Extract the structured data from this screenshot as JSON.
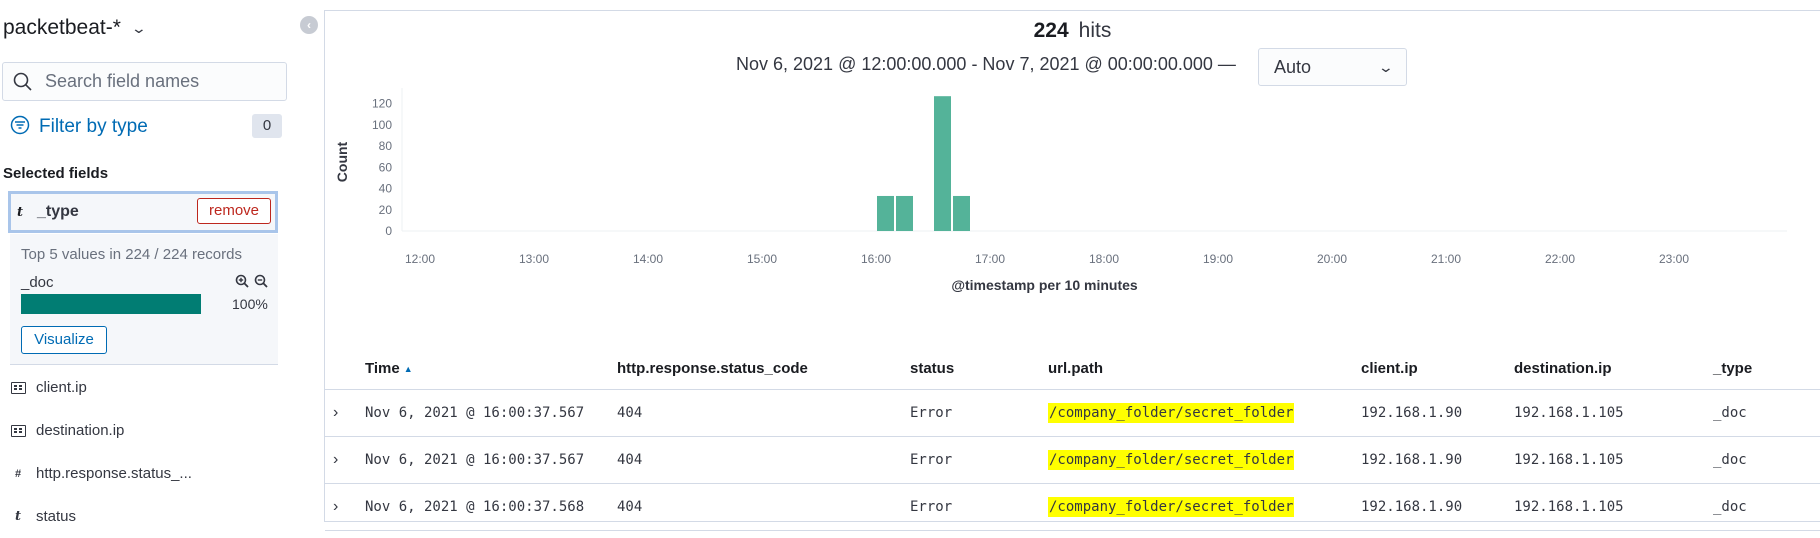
{
  "sidebar": {
    "index_pattern": "packetbeat-*",
    "search_placeholder": "Search field names",
    "filter_label": "Filter by type",
    "filter_count": "0",
    "selected_fields_title": "Selected fields",
    "selected_field": {
      "type": "t",
      "name": "_type",
      "remove_label": "remove",
      "top_values_caption": "Top 5 values in 224 / 224 records",
      "value_name": "_doc",
      "value_percent": "100%",
      "value_fraction": 1.0,
      "visualize_label": "Visualize"
    },
    "fields": [
      {
        "type": "ip",
        "name": "client.ip"
      },
      {
        "type": "ip",
        "name": "destination.ip"
      },
      {
        "type": "#",
        "name": "http.response.status_..."
      },
      {
        "type": "t",
        "name": "status"
      }
    ]
  },
  "main": {
    "hits_count": "224",
    "hits_label": "hits",
    "time_range": "Nov 6, 2021 @ 12:00:00.000 - Nov 7, 2021 @ 00:00:00.000 —",
    "interval": "Auto"
  },
  "chart_data": {
    "type": "bar",
    "ylabel": "Count",
    "xlabel": "@timestamp per 10 minutes",
    "ylim": [
      0,
      130
    ],
    "yticks": [
      0,
      20,
      40,
      60,
      80,
      100,
      120
    ],
    "xticks": [
      "12:00",
      "13:00",
      "14:00",
      "15:00",
      "16:00",
      "17:00",
      "18:00",
      "19:00",
      "20:00",
      "21:00",
      "22:00",
      "23:00"
    ],
    "x_range": [
      "12:00",
      "24:00"
    ],
    "bar_width_minutes": 10,
    "color": "#54b399",
    "bars": [
      {
        "x": "16:00",
        "value": 33
      },
      {
        "x": "16:10",
        "value": 33
      },
      {
        "x": "16:30",
        "value": 127
      },
      {
        "x": "16:40",
        "value": 33
      }
    ],
    "grid": false
  },
  "table": {
    "headers": [
      "Time",
      "http.response.status_code",
      "status",
      "url.path",
      "client.ip",
      "destination.ip",
      "_type"
    ],
    "rows": [
      [
        "Nov 6, 2021 @ 16:00:37.567",
        "404",
        "Error",
        "/company_folder/secret_folder",
        "192.168.1.90",
        "192.168.1.105",
        "_doc"
      ],
      [
        "Nov 6, 2021 @ 16:00:37.567",
        "404",
        "Error",
        "/company_folder/secret_folder",
        "192.168.1.90",
        "192.168.1.105",
        "_doc"
      ],
      [
        "Nov 6, 2021 @ 16:00:37.568",
        "404",
        "Error",
        "/company_folder/secret_folder",
        "192.168.1.90",
        "192.168.1.105",
        "_doc"
      ]
    ]
  }
}
